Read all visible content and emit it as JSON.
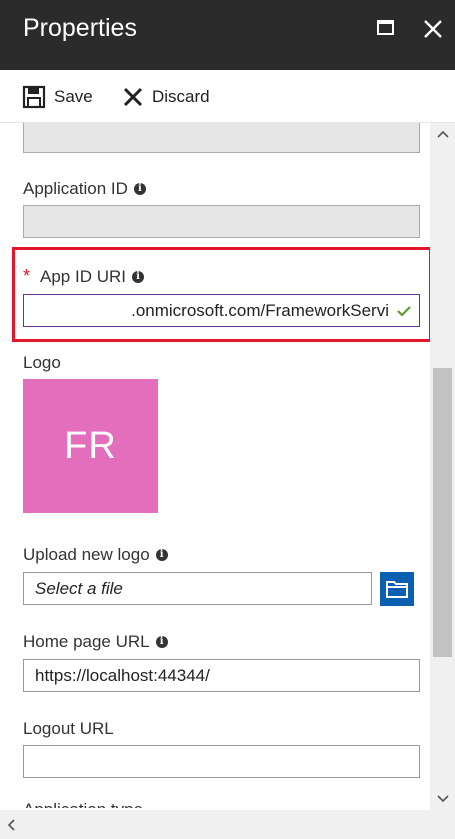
{
  "window": {
    "title": "Properties"
  },
  "toolbar": {
    "save_label": "Save",
    "discard_label": "Discard"
  },
  "fields": {
    "application_id": {
      "label": "Application ID"
    },
    "app_id_uri": {
      "required_mark": "*",
      "label": "App ID URI",
      "value": ".onmicrosoft.com/FrameworkServi"
    },
    "logo": {
      "label": "Logo",
      "initials": "FR",
      "color": "#e36fbc"
    },
    "upload_logo": {
      "label": "Upload new logo",
      "placeholder": "Select a file"
    },
    "home_page_url": {
      "label": "Home page URL",
      "value": "https://localhost:44344/"
    },
    "logout_url": {
      "label": "Logout URL",
      "value": ""
    },
    "next_partial": {
      "label": "Application type"
    }
  },
  "colors": {
    "titlebar": "#2b2b2b",
    "highlight": "#e0162b",
    "folder_button": "#0b5fb0",
    "valid_check": "#5c9e2f"
  }
}
